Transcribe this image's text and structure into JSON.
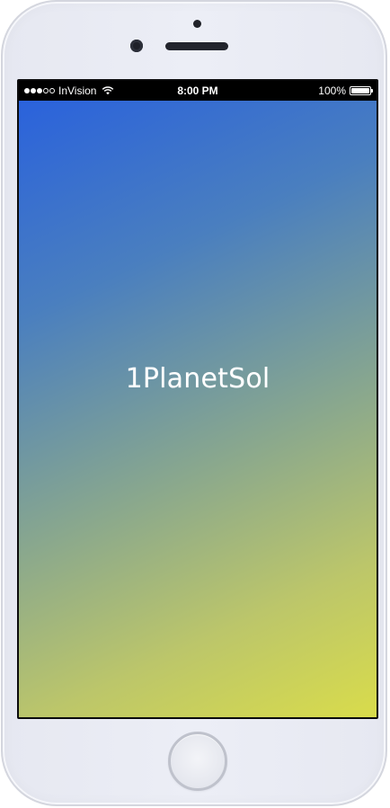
{
  "status_bar": {
    "carrier": "InVision",
    "signal_bars_filled": 3,
    "signal_bars_total": 5,
    "time": "8:00 PM",
    "battery_percent_text": "100%",
    "battery_level": 1.0,
    "icons": {
      "wifi": "wifi-icon",
      "battery": "battery-icon",
      "signal": "signal-icon"
    }
  },
  "screen": {
    "title": "1PlanetSol",
    "gradient_colors": [
      "#2a62dc",
      "#4a7fbf",
      "#8aa88d",
      "#bcc66a",
      "#d9dc4b"
    ],
    "title_color": "#ffffff"
  },
  "device": {
    "frame_color": "#e6e8f1",
    "home_button": "home-button"
  }
}
